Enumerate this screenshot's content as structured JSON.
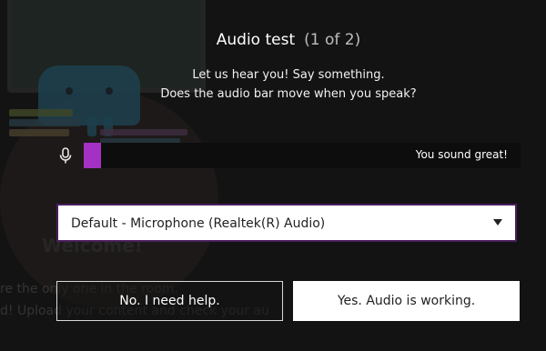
{
  "dialog": {
    "title": "Audio test",
    "step": "(1 of 2)",
    "prompt_line1": "Let us hear you! Say something.",
    "prompt_line2": "Does the audio bar move when you speak?"
  },
  "meter": {
    "icon": "microphone-icon",
    "level_percent": 4,
    "status": "You sound great!",
    "fill_color": "#a531c4"
  },
  "device_select": {
    "selected": "Default - Microphone (Realtek(R) Audio)"
  },
  "buttons": {
    "help_label": "No. I need help.",
    "ok_label": "Yes. Audio is working."
  },
  "background": {
    "welcome": "Welcome!",
    "line1": "re the only one in the room.",
    "line2": "d! Upload your content and check your au"
  }
}
